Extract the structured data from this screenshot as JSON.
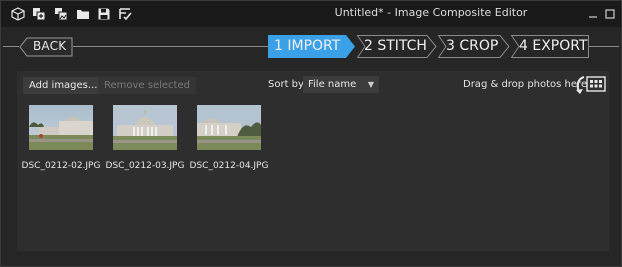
{
  "window": {
    "title": "Untitled* - Image Composite Editor"
  },
  "titlebar_icons": [
    "box-icon",
    "new-project-icon",
    "open-images-icon",
    "folder-icon",
    "save-icon",
    "export-check-icon"
  ],
  "steps": {
    "back": "BACK",
    "items": [
      {
        "label": "1 IMPORT",
        "active": true
      },
      {
        "label": "2 STITCH",
        "active": false
      },
      {
        "label": "3 CROP",
        "active": false
      },
      {
        "label": "4 EXPORT",
        "active": false
      }
    ]
  },
  "toolbar": {
    "add_label": "Add images...",
    "remove_label": "Remove selected",
    "sort_label": "Sort by",
    "sort_value": "File name",
    "drag_hint": "Drag & drop photos here"
  },
  "images": [
    {
      "name": "DSC_0212-02.JPG"
    },
    {
      "name": "DSC_0212-03.JPG"
    },
    {
      "name": "DSC_0212-04.JPG"
    }
  ],
  "colors": {
    "accent": "#3aa0e8",
    "background": "#262626",
    "panel": "#2e2e2e"
  }
}
